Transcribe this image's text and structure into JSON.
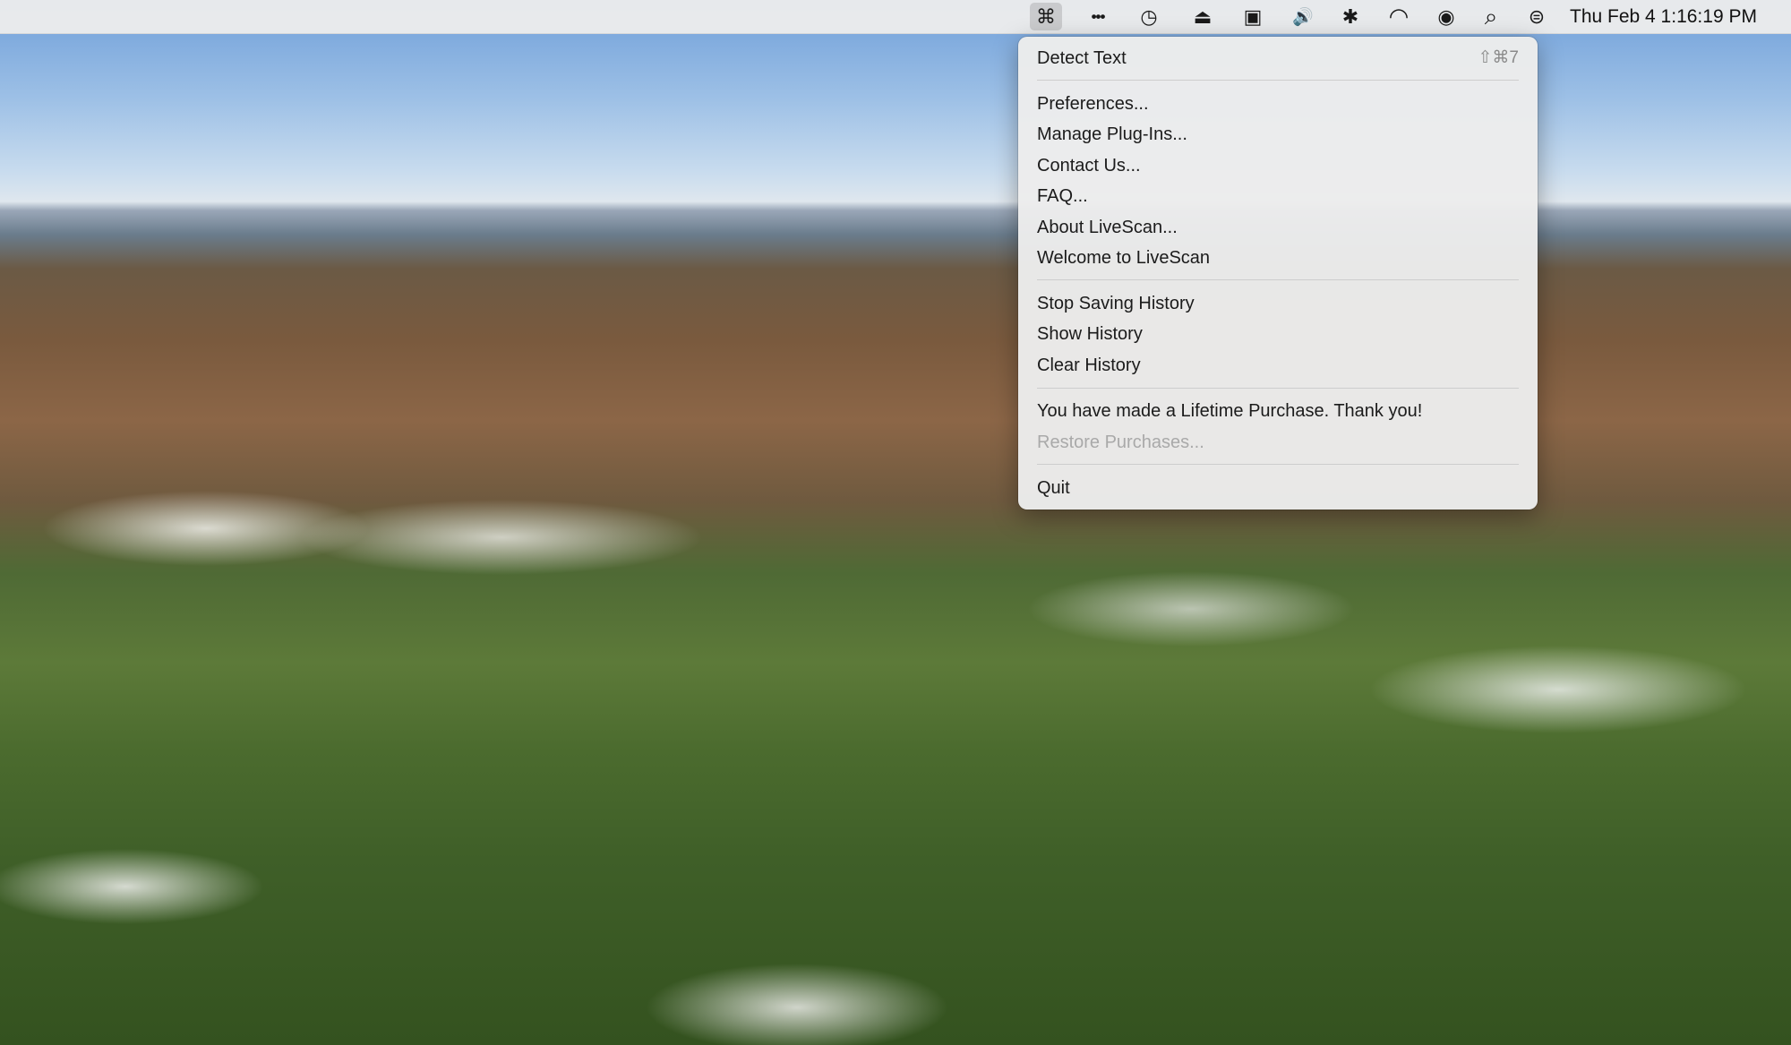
{
  "menubar": {
    "icons": [
      {
        "name": "livescan-icon",
        "glyph": "⌘"
      },
      {
        "name": "ellipsis-icon",
        "glyph": "•••"
      },
      {
        "name": "time-machine-icon",
        "glyph": "◷"
      },
      {
        "name": "eject-icon",
        "glyph": "⏏"
      },
      {
        "name": "window-icon",
        "glyph": "▣"
      },
      {
        "name": "volume-icon",
        "glyph": "🔊"
      },
      {
        "name": "bluetooth-icon",
        "glyph": "✱"
      },
      {
        "name": "wifi-icon",
        "glyph": "◠"
      },
      {
        "name": "user-icon",
        "glyph": "◉"
      },
      {
        "name": "search-icon",
        "glyph": "⌕"
      },
      {
        "name": "control-center-icon",
        "glyph": "⊜"
      }
    ],
    "clock": "Thu Feb 4  1:16:19 PM"
  },
  "menu": {
    "detect_text": "Detect Text",
    "detect_text_shortcut": "⇧⌘7",
    "preferences": "Preferences...",
    "manage_plugins": "Manage Plug-Ins...",
    "contact_us": "Contact Us...",
    "faq": "FAQ...",
    "about": "About LiveScan...",
    "welcome": "Welcome to LiveScan",
    "stop_saving_history": "Stop Saving History",
    "show_history": "Show History",
    "clear_history": "Clear History",
    "lifetime_purchase": "You have made a Lifetime Purchase. Thank you!",
    "restore_purchases": "Restore Purchases...",
    "quit": "Quit"
  },
  "colors": {
    "menu_text": "#1b1b1b",
    "disabled_text": "#a9a9a9",
    "menubar_bg": "#ececec"
  }
}
